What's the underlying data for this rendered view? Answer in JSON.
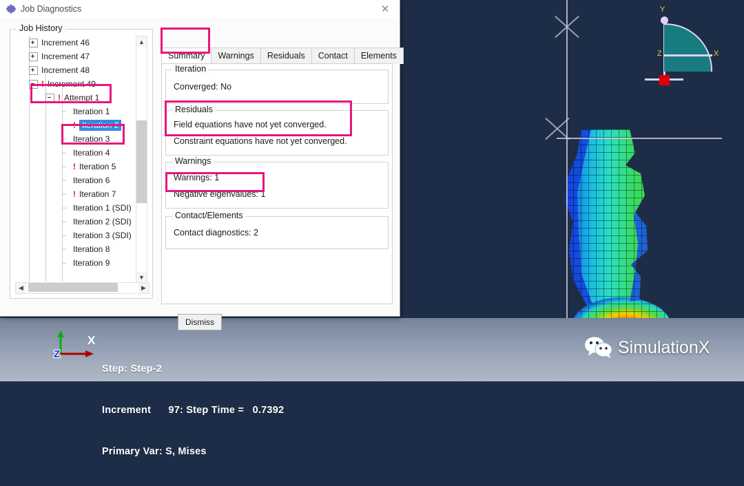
{
  "window": {
    "title": "Job Diagnostics",
    "app_icon": "abaqus-logo-icon",
    "close_icon": "close-icon"
  },
  "job_history": {
    "group_label": "Job History",
    "tree": [
      {
        "label": "Increment 46",
        "indent": 1,
        "marker": "plus",
        "error": false,
        "selected": false
      },
      {
        "label": "Increment 47",
        "indent": 1,
        "marker": "plus",
        "error": false,
        "selected": false
      },
      {
        "label": "Increment 48",
        "indent": 1,
        "marker": "plus",
        "error": false,
        "selected": false
      },
      {
        "label": "Increment 49",
        "indent": 1,
        "marker": "minus",
        "error": true,
        "selected": false
      },
      {
        "label": "Attempt 1",
        "indent": 2,
        "marker": "minus",
        "error": true,
        "selected": false
      },
      {
        "label": "Iteration 1",
        "indent": 3,
        "marker": "dash",
        "error": false,
        "selected": false
      },
      {
        "label": "Iteration 2",
        "indent": 3,
        "marker": "dash",
        "error": true,
        "selected": true
      },
      {
        "label": "Iteration 3",
        "indent": 3,
        "marker": "dash",
        "error": false,
        "selected": false
      },
      {
        "label": "Iteration 4",
        "indent": 3,
        "marker": "dash",
        "error": false,
        "selected": false
      },
      {
        "label": "Iteration 5",
        "indent": 3,
        "marker": "dash",
        "error": true,
        "selected": false
      },
      {
        "label": "Iteration 6",
        "indent": 3,
        "marker": "dash",
        "error": false,
        "selected": false
      },
      {
        "label": "Iteration 7",
        "indent": 3,
        "marker": "dash",
        "error": true,
        "selected": false
      },
      {
        "label": "Iteration 1 (SDI)",
        "indent": 3,
        "marker": "dash",
        "error": false,
        "selected": false
      },
      {
        "label": "Iteration 2 (SDI)",
        "indent": 3,
        "marker": "dash",
        "error": false,
        "selected": false
      },
      {
        "label": "Iteration 3 (SDI)",
        "indent": 3,
        "marker": "dash",
        "error": false,
        "selected": false
      },
      {
        "label": "Iteration 8",
        "indent": 3,
        "marker": "dash",
        "error": false,
        "selected": false
      },
      {
        "label": "Iteration 9",
        "indent": 3,
        "marker": "dash",
        "error": false,
        "selected": false
      }
    ],
    "scroll_up_icon": "chevron-up-icon",
    "scroll_down_icon": "chevron-down-icon",
    "scroll_left_icon": "chevron-left-icon",
    "scroll_right_icon": "chevron-right-icon"
  },
  "tabs": [
    {
      "label": "Summary",
      "active": true
    },
    {
      "label": "Warnings",
      "active": false
    },
    {
      "label": "Residuals",
      "active": false
    },
    {
      "label": "Contact",
      "active": false
    },
    {
      "label": "Elements",
      "active": false
    }
  ],
  "summary": {
    "iteration": {
      "group_label": "Iteration",
      "converged": "Converged: No"
    },
    "residuals": {
      "group_label": "Residuals",
      "line1": "Field equations have not yet converged.",
      "line2": "Constraint equations have not yet converged."
    },
    "warnings": {
      "group_label": "Warnings",
      "count": "Warnings: 1",
      "negative_eigenvalues": "Negative eigenvalues: 1"
    },
    "contact": {
      "group_label": "Contact/Elements",
      "diagnostics": "Contact diagnostics: 2"
    }
  },
  "buttons": {
    "dismiss": "Dismiss"
  },
  "viewport": {
    "status": {
      "step": "Step: Step-2",
      "increment": "Increment      97: Step Time =   0.7392",
      "primary_var": "Primary Var: S, Mises"
    },
    "triad": {
      "x_label": "X",
      "y_label": "",
      "z_label": "Z"
    },
    "gizmo": {
      "y_label": "Y",
      "x_label": "X",
      "z_label": "Z"
    },
    "watermark": {
      "text": "SimulationX",
      "icon": "wechat-icon"
    }
  },
  "colors": {
    "highlight": "#e8157f",
    "selection": "#2f8ce0",
    "error_marker": "#e21b1b",
    "viewport_bg": "#1e2d47",
    "gizmo_fill": "#177b80",
    "triad_x": "#b00000",
    "triad_y": "#11a911",
    "triad_z": "#1a3fd0"
  }
}
